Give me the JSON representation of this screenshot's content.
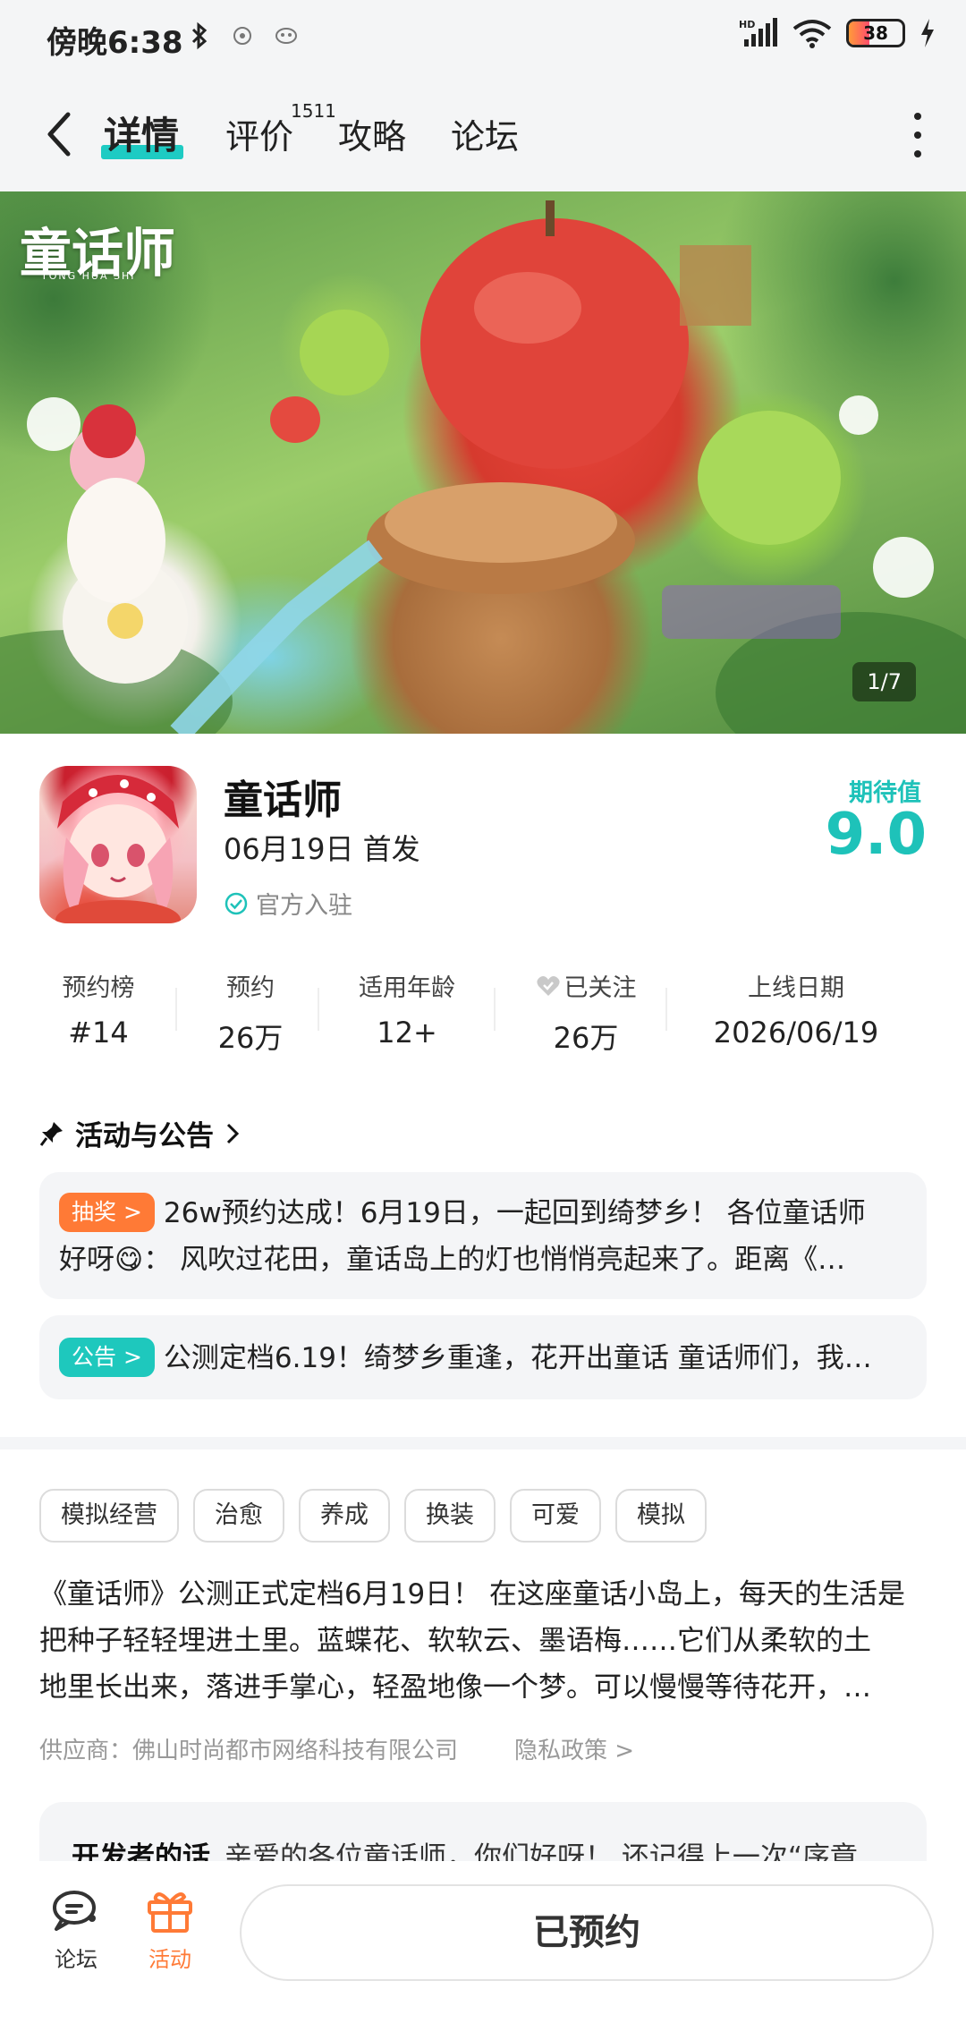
{
  "status_bar": {
    "time": "傍晚6:38",
    "battery": "38",
    "battery_level": 0.38,
    "network_label": "HD"
  },
  "nav": {
    "tabs": [
      {
        "label": "详情",
        "active": true
      },
      {
        "label": "评价",
        "badge": "1511"
      },
      {
        "label": "攻略"
      },
      {
        "label": "论坛"
      }
    ],
    "accent": "#1ecbc3"
  },
  "banner": {
    "logo_text": "童话师",
    "logo_subtext": "TONG HUA SHI",
    "pager": "1/7"
  },
  "game": {
    "title": "童话师",
    "release": "06月19日 首发",
    "official": "官方入驻",
    "rating_label": "期待值",
    "rating_value": "9.0"
  },
  "stats": [
    {
      "label": "预约榜",
      "value": "#14"
    },
    {
      "label": "预约",
      "value": "26万"
    },
    {
      "label": "适用年龄",
      "value": "12+"
    },
    {
      "label": "已关注",
      "value": "26万"
    },
    {
      "label": "上线日期",
      "value": "2026/06/19"
    }
  ],
  "activities": {
    "header": "活动与公告",
    "items": [
      {
        "badge": "抽奖 >",
        "text_line1": "26w预约达成！6月19日，一起回到绮梦乡！ 各位童话师",
        "text_line2": "好呀😋： 风吹过花田，童话岛上的灯也悄悄亮起来了。距离《…",
        "badge_color": "#ff7a36"
      },
      {
        "badge": "公告 >",
        "text_line1": "公测定档6.19！绮梦乡重逢，花开出童话 童话师们，我…",
        "badge_color": "#1ec8bd"
      }
    ]
  },
  "tags": [
    "模拟经营",
    "治愈",
    "养成",
    "换装",
    "可爱",
    "模拟"
  ],
  "description": {
    "line1": "《童话师》公测正式定档6月19日！ 在这座童话小岛上，每天的生活是",
    "line2": "把种子轻轻埋进土里。蓝蝶花、软软云、墨语梅……它们从柔软的土",
    "line3": "地里长出来，落进手掌心，轻盈地像一个梦。可以慢慢等待花开，…"
  },
  "supplier": "供应商：佛山时尚都市网络科技有限公司",
  "privacy": "隐私政策 >",
  "developer": {
    "label": "开发者的话",
    "text": "亲爱的各位童话师，你们好呀！ 还记得上一次“序章"
  },
  "bottom_bar": {
    "forum": "论坛",
    "activity": "活动",
    "reserve": "已预约",
    "activity_color": "#ff7a36"
  }
}
